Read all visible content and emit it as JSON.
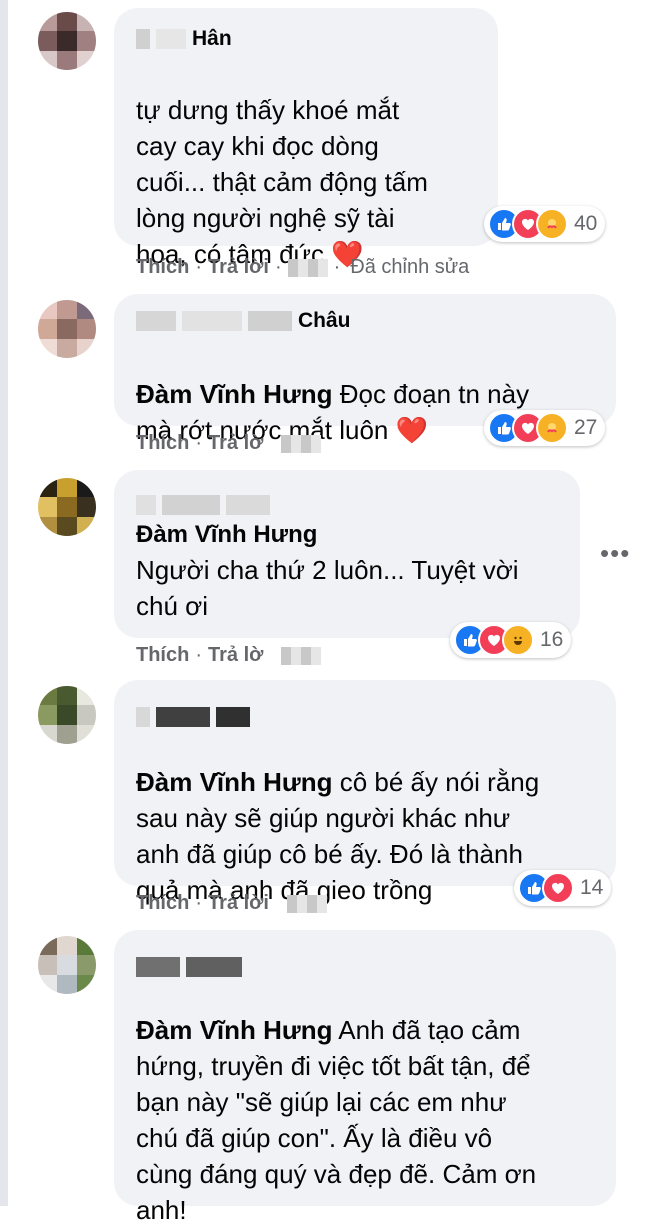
{
  "comments": [
    {
      "name_partial": "Hân",
      "text": "tự dưng thấy khoé mắt\ncay cay khi đọc dòng\ncuối... thật cảm động tấm\nlòng người nghệ sỹ tài\nhoa, có tâm đức",
      "mention": "",
      "heart": "❤️",
      "reaction_count": "40",
      "like": "Thích",
      "reply": "Trả lời",
      "edited": "Đã chỉnh sửa"
    },
    {
      "name_partial": "Châu",
      "mention": "Đàm Vĩnh Hưng",
      "text": " Đọc đoạn tn này\nmà rớt nước mắt luôn",
      "heart": "❤️",
      "reaction_count": "27",
      "like": "Thích",
      "reply": "Trả lờ"
    },
    {
      "mention": "Đàm Vĩnh Hưng",
      "text": "Người cha thứ 2 luôn... Tuyệt vời\nchú ơi",
      "reaction_count": "16",
      "like": "Thích",
      "reply": "Trả lờ"
    },
    {
      "mention": "Đàm Vĩnh Hưng",
      "text": " cô bé ấy nói rằng\nsau này sẽ giúp người khác như\nanh đã giúp cô bé ấy. Đó là thành\nquả mà anh đã gieo trồng",
      "reaction_count": "14",
      "like": "Thích",
      "reply": "Trả lời"
    },
    {
      "mention": "Đàm Vĩnh Hưng",
      "text": " Anh đã tạo cảm\nhứng, truyền đi việc tốt bất tận, để\nbạn này \"sẽ giúp lại các em như\nchú đã giúp con\". Ấy là điều vô\ncùng đáng quý và đẹp đẽ. Cảm ơn\nanh!"
    }
  ],
  "more_label": "•••",
  "colors": {
    "like": "#1877f2",
    "love": "#f33e58",
    "care": "#f7b125",
    "bubble": "#f0f2f5",
    "meta": "#65676b"
  },
  "icons": [
    "like-icon",
    "love-icon",
    "care-icon",
    "haha-icon",
    "more-icon"
  ]
}
